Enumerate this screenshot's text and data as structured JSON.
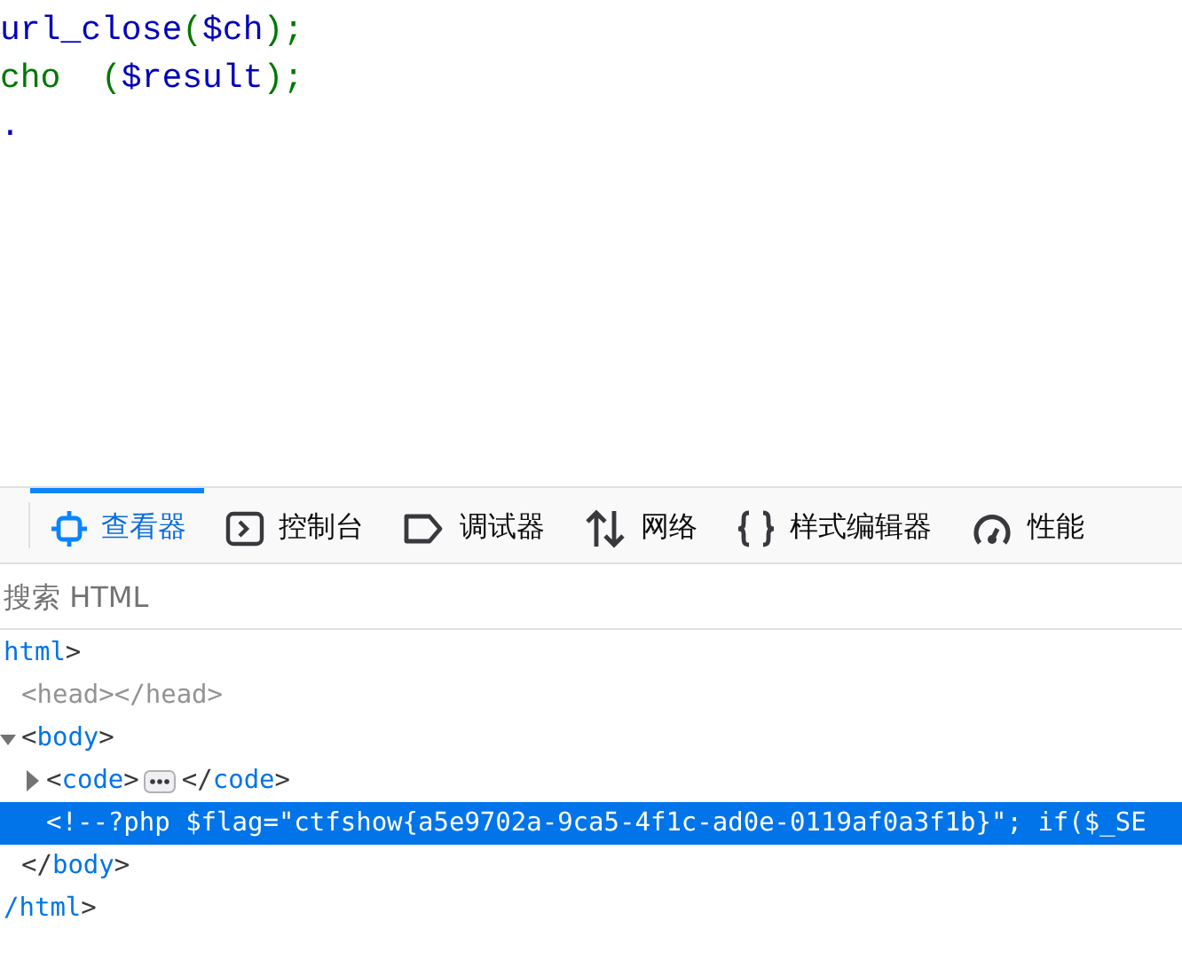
{
  "source_code": {
    "lines": [
      [
        {
          "kind": "plain",
          "text": "url_close"
        },
        {
          "kind": "keyword",
          "text": "("
        },
        {
          "kind": "plain",
          "text": "$ch"
        },
        {
          "kind": "keyword",
          "text": ");"
        }
      ],
      [
        {
          "kind": "keyword",
          "text": "cho  ("
        },
        {
          "kind": "plain",
          "text": "$result"
        },
        {
          "kind": "keyword",
          "text": ");"
        }
      ],
      [
        {
          "kind": "plain",
          "text": "."
        }
      ]
    ]
  },
  "devtools": {
    "tabs": [
      {
        "label": "查看器",
        "kind": "inspector",
        "selected": true
      },
      {
        "label": "控制台",
        "kind": "console",
        "selected": false
      },
      {
        "label": "调试器",
        "kind": "debugger",
        "selected": false
      },
      {
        "label": "网络",
        "kind": "network",
        "selected": false
      },
      {
        "label": "样式编辑器",
        "kind": "style",
        "selected": false
      },
      {
        "label": "性能",
        "kind": "performance",
        "selected": false
      }
    ],
    "search": {
      "placeholder": "搜索 HTML"
    },
    "tree": [
      {
        "kind": "element",
        "open": "html>",
        "close": "/html>",
        "expanded": true,
        "selected": false,
        "children": [
          {
            "kind": "empty",
            "text": "<head></head>",
            "selected": false
          },
          {
            "kind": "element",
            "open": "<body>",
            "close": "</body>",
            "expanded": true,
            "selected": false,
            "children": [
              {
                "kind": "element",
                "open": "<code>",
                "close": "</code>",
                "expanded": false,
                "selected": false
              },
              {
                "kind": "comment",
                "text": "<!--?php $flag=\"ctfshow{a5e9702a-9ca5-4f1c-ad0e-0119af0a3f1b}\"; if($_SE",
                "selected": true
              }
            ]
          }
        ]
      }
    ]
  }
}
